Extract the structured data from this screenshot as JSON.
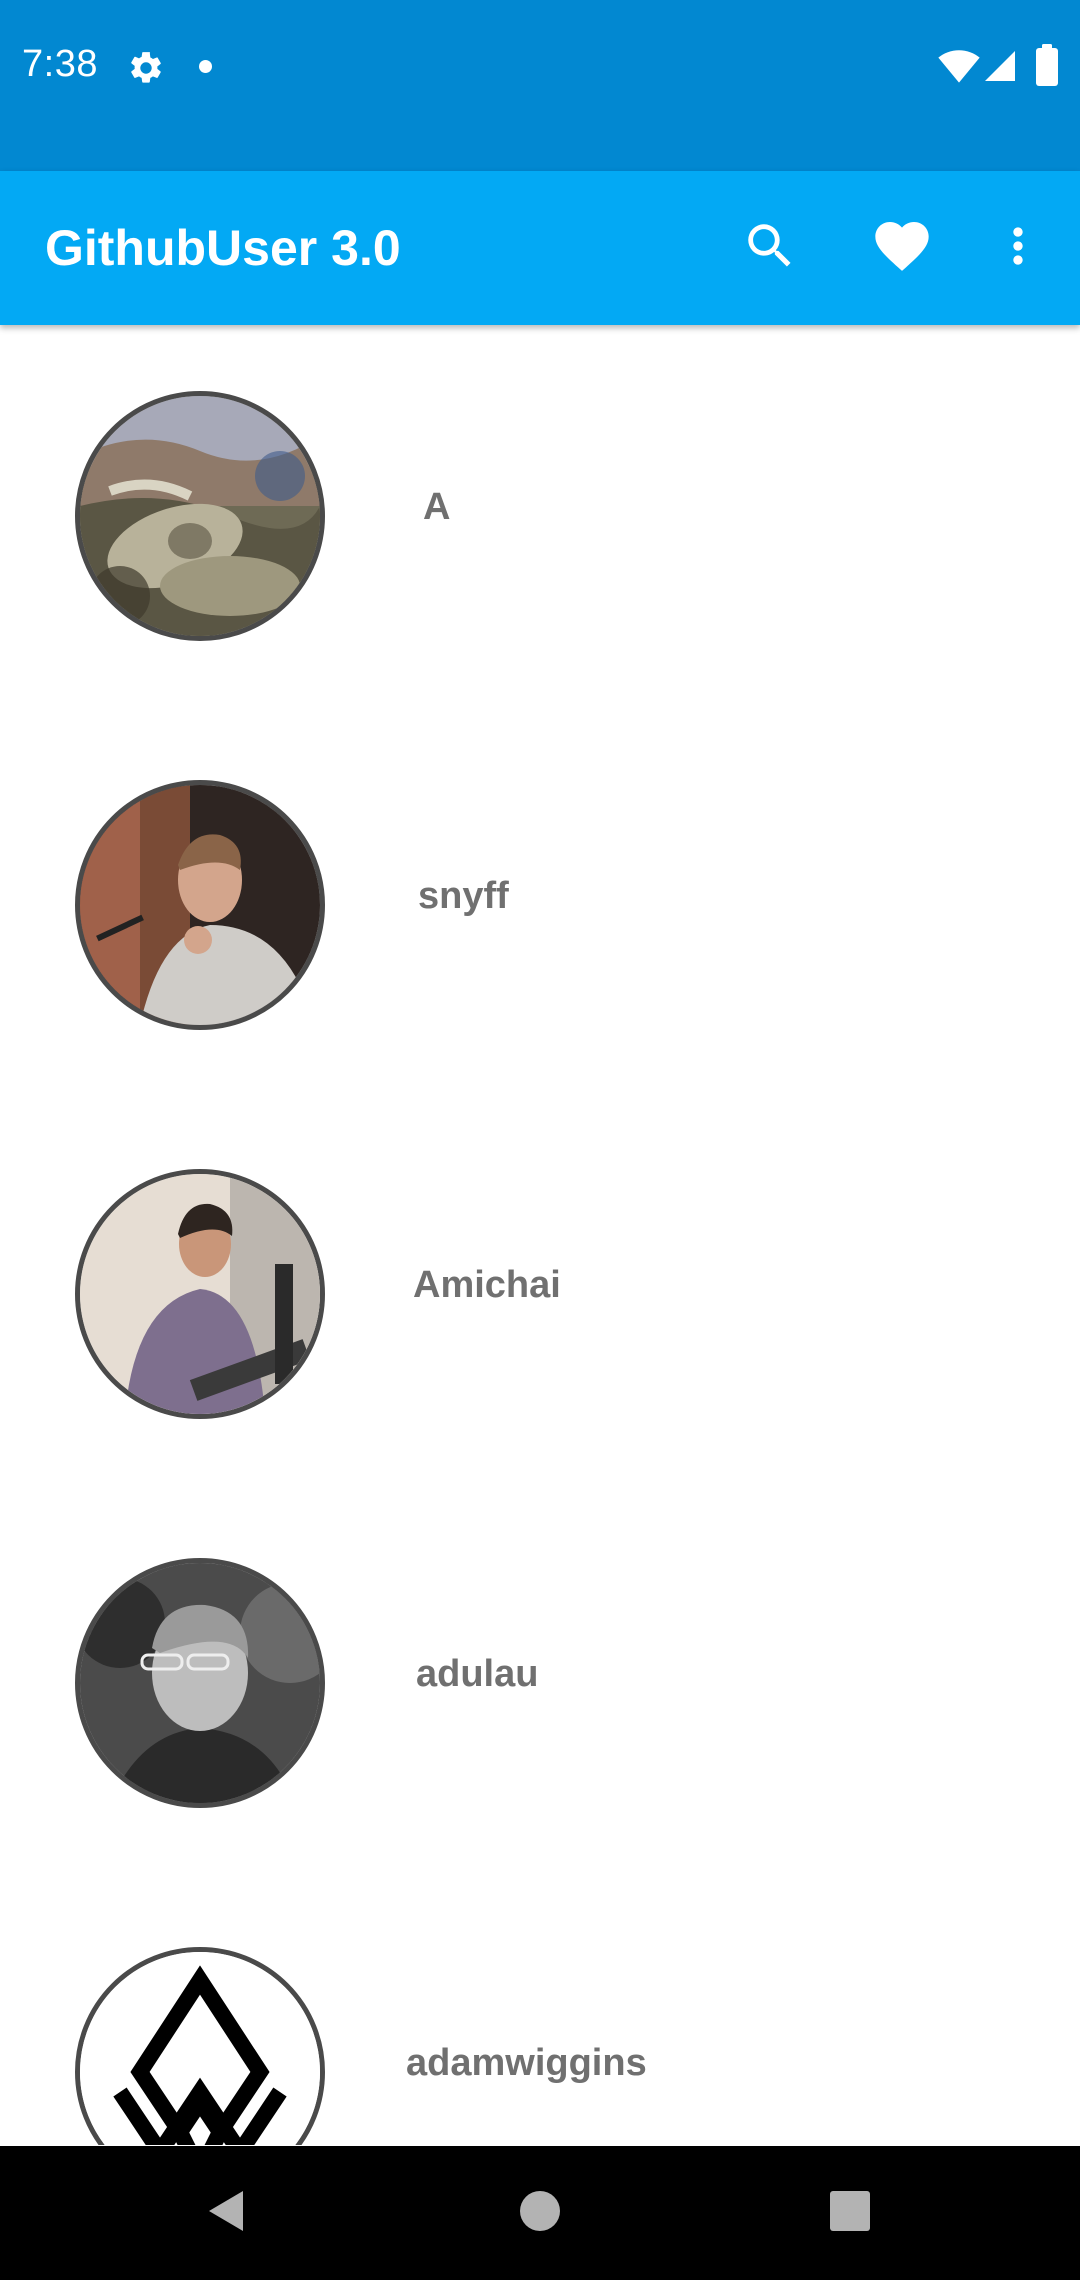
{
  "status_bar": {
    "time": "7:38",
    "icons": [
      "gear-icon",
      "notification-dot-icon",
      "wifi-icon",
      "cell-signal-icon",
      "battery-icon"
    ]
  },
  "app_bar": {
    "title": "GithubUser 3.0",
    "actions": [
      "search-icon",
      "heart-icon",
      "more-vert-icon"
    ]
  },
  "users": [
    {
      "login": "A"
    },
    {
      "login": "snyff"
    },
    {
      "login": "Amichai"
    },
    {
      "login": "adulau"
    },
    {
      "login": "adamwiggins"
    }
  ],
  "nav_bar": {
    "buttons": [
      "back-icon",
      "home-icon",
      "recents-icon"
    ]
  },
  "colors": {
    "status_bar": "#0288d1",
    "app_bar": "#03a9f4",
    "name_text": "#707070",
    "avatar_border": "#4a4a4a",
    "nav_bar": "#000000"
  }
}
